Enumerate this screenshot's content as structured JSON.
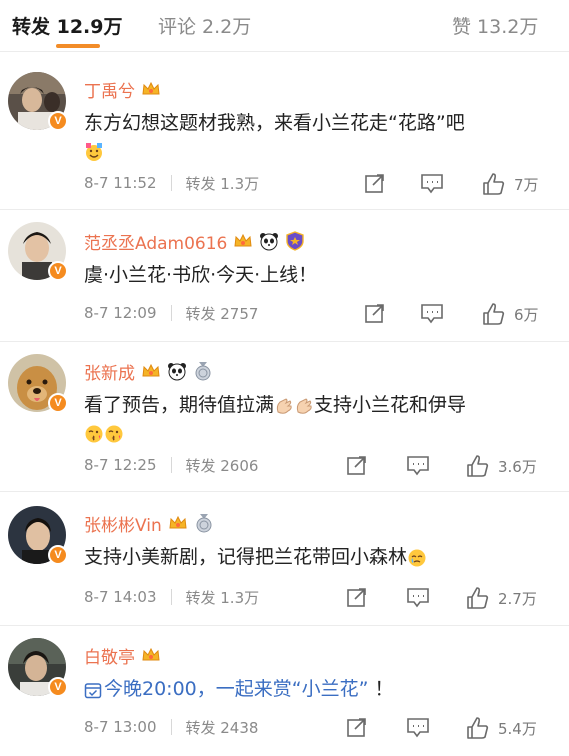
{
  "tabs": {
    "repost": "转发 12.9万",
    "comment": "评论 2.2万",
    "like": "赞 13.2万"
  },
  "accent_color": "#f28c28",
  "name_color": "#eb7350",
  "comments": [
    {
      "name": "丁禹兮",
      "text": "东方幻想这题材我熟，来看小兰花走“花路”吧",
      "date": "8-7 11:52",
      "repost": "转发 1.3万",
      "likes": "7万",
      "badges": [
        "crown-icon"
      ],
      "emoji": [
        "applause-emoji"
      ]
    },
    {
      "name": "范丞丞Adam0616",
      "text": "虞·小兰花·书欣·今天·上线！",
      "date": "8-7 12:09",
      "repost": "转发 2757",
      "likes": "6万",
      "badges": [
        "crown-icon",
        "panda-icon",
        "shield-icon"
      ]
    },
    {
      "name": "张新成",
      "text_before": "看了预告，期待值拉满",
      "text_after": "支持小兰花和伊导",
      "date": "8-7 12:25",
      "repost": "转发 2606",
      "likes": "3.6万",
      "badges": [
        "crown-icon",
        "panda-icon",
        "medal-icon"
      ],
      "emoji": [
        "clap-emoji",
        "clap-emoji",
        "kiss-emoji",
        "kiss-emoji"
      ]
    },
    {
      "name": "张彬彬Vin",
      "text": "支持小美新剧，记得把兰花带回小森林",
      "date": "8-7 14:03",
      "repost": "转发 1.3万",
      "likes": "2.7万",
      "badges": [
        "crown-icon",
        "medal-icon"
      ],
      "emoji": [
        "teary-emoji"
      ]
    },
    {
      "name": "白敬亭",
      "topic": "今晚20:00，一起来赏“小兰花”",
      "text_after": "！",
      "date": "8-7 13:00",
      "repost": "转发 2438",
      "likes": "5.4万",
      "badges": [
        "crown-icon"
      ]
    }
  ]
}
